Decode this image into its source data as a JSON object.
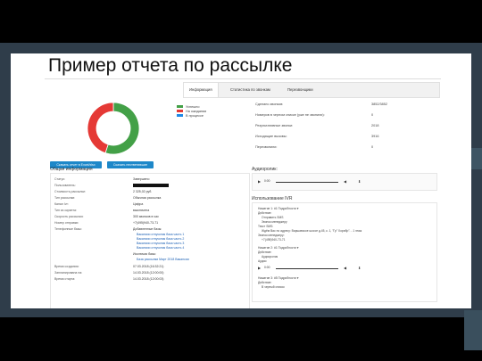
{
  "slide": {
    "title": "Пример отчета по рассылке"
  },
  "tabs": [
    "Информация",
    "Статистика по звонкам",
    "Перезвонщики"
  ],
  "legend": [
    {
      "label": "Успешно",
      "color": "#43a047"
    },
    {
      "label": "На ожидании",
      "color": "#e53935"
    },
    {
      "label": "В процессе",
      "color": "#1e88e5"
    }
  ],
  "chart_data": {
    "type": "pie",
    "categories": [
      "Успешно",
      "На ожидании",
      "В процессе"
    ],
    "values": [
      55,
      45,
      0
    ],
    "colors": [
      "#43a047",
      "#e53935",
      "#1e88e5"
    ],
    "title": "",
    "legend": "right"
  },
  "stats": [
    {
      "label": "Сделано звонков:",
      "value": "3852/3852"
    },
    {
      "label": "Номеров в черном списке (уже не звонили):",
      "value": "0"
    },
    {
      "label": "Результативные звонки:",
      "value": "2018"
    },
    {
      "label": "Исходящие вызовы:",
      "value": "3916"
    },
    {
      "label": "Перезвонили:",
      "value": "0"
    }
  ],
  "buttons": {
    "download_report": "Скачать отчет в Excel/xlsx",
    "download_numbers": "Скачать неответившие"
  },
  "info": {
    "title": "Общая информация",
    "rows": [
      {
        "label": "Статус:",
        "value": "Завершено"
      },
      {
        "label": "Пользователь:",
        "value": ""
      },
      {
        "label": "Стоимость рассылки:",
        "value": "2 325,02 руб."
      },
      {
        "label": "Тип рассылки:",
        "value": "Обычная рассылка"
      },
      {
        "label": "Канал Ivr:",
        "value": "Цифра"
      },
      {
        "label": "Тип из скрипта:",
        "value": "выключена"
      },
      {
        "label": "Скорость рассылки:",
        "value": "300 звонков в час"
      },
      {
        "label": "Номер отправки:",
        "value": "+7(495)940-73-71"
      },
      {
        "label": "Телефонные базы:",
        "value": "Добавленные базы:"
      }
    ],
    "bases_added": [
      "Вакансии отпускник база часть 1",
      "Вакансии отпускник база часть 2",
      "Вакансии отпускник база часть 3",
      "Вакансии отпускник база часть 4"
    ],
    "bases_excluded_label": "Исключая базы:",
    "bases_excluded": [
      "База рассылки Март 2018 Вакансии"
    ],
    "dates": [
      {
        "label": "Время создания:",
        "value": "07.03.2018 (16:32:21)"
      },
      {
        "label": "Запланирована на:",
        "value": "14.03.2018 (12:00:00)"
      },
      {
        "label": "Время старта:",
        "value": "14.03.2018 (12:00:03)"
      }
    ]
  },
  "audio": {
    "title": "Аудиоролик:",
    "time": "0:00"
  },
  "ivr": {
    "title": "Использование IVR",
    "lines": [
      "Нажатие 1: #1  Подробности ▾",
      "Действие:",
      "Отправить SMS",
      "Звонок менеджеру",
      "Текст SMS:",
      "Ждём Вас по адресу: Варшавское шоссе д.45, к. 1, \"Гр\" Хорибр\". - 1 этаж",
      "Звонок менеджеру:",
      "+7(495)940-73-71",
      "Нажатие 2: #1  Подробности ▾",
      "Действие:",
      "Аудиоролик",
      "Аудио:",
      "Нажатие 3: #5  Подробности ▾",
      "Действие:",
      "В черный список"
    ],
    "time": "0:00"
  }
}
